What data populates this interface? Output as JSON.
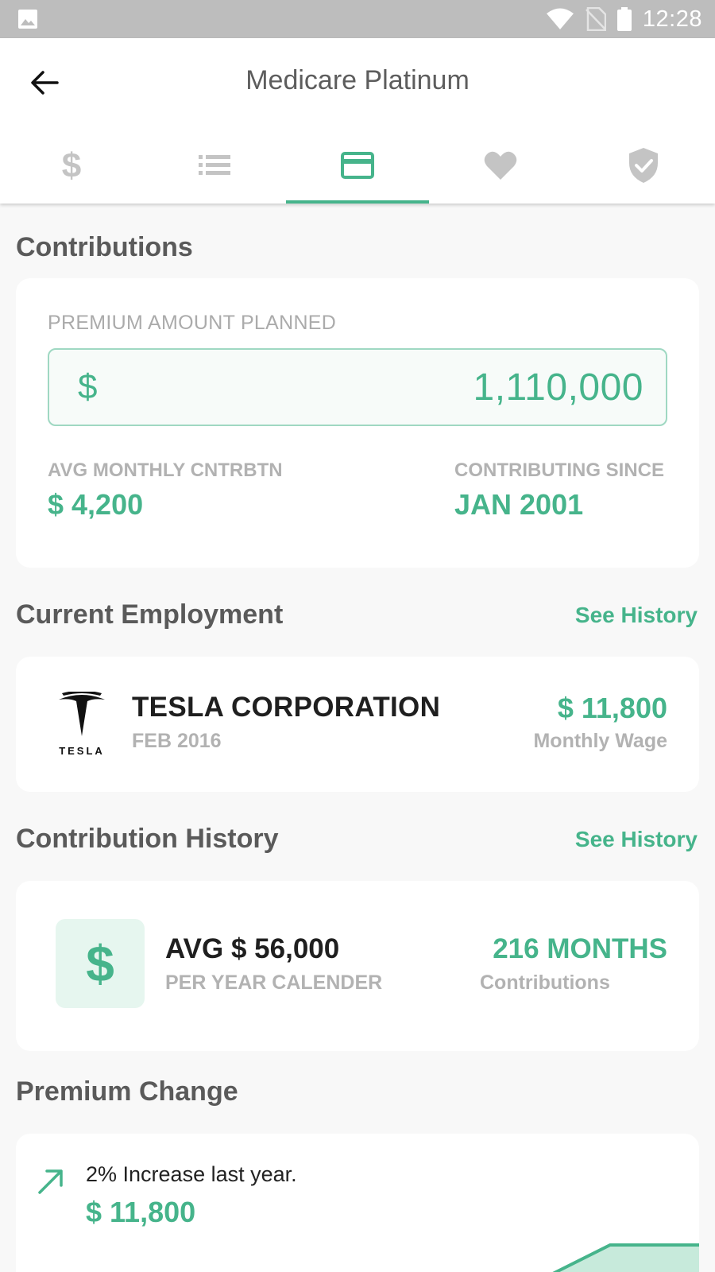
{
  "status_bar": {
    "time": "12:28"
  },
  "header": {
    "title": "Medicare Platinum"
  },
  "tabs": [
    {
      "icon": "dollar-icon",
      "active": false
    },
    {
      "icon": "list-icon",
      "active": false
    },
    {
      "icon": "credit-card-icon",
      "active": true
    },
    {
      "icon": "heart-icon",
      "active": false
    },
    {
      "icon": "shield-check-icon",
      "active": false
    }
  ],
  "colors": {
    "accent": "#46b48b",
    "tab_inactive": "#c4c4c4"
  },
  "contributions": {
    "title": "Contributions",
    "premium_label": "PREMIUM AMOUNT PLANNED",
    "currency": "$",
    "premium_amount": "1,110,000",
    "avg_monthly_label": "AVG MONTHLY CNTRBTN",
    "avg_monthly_value": "$ 4,200",
    "since_label": "CONTRIBUTING SINCE",
    "since_value": "JAN 2001"
  },
  "employment": {
    "title": "Current Employment",
    "see_history": "See History",
    "company": "TESLA CORPORATION",
    "logo_text": "TESLA",
    "start": "FEB 2016",
    "wage": "$ 11,800",
    "wage_label": "Monthly Wage"
  },
  "history": {
    "title": "Contribution History",
    "see_history": "See History",
    "icon_glyph": "$",
    "avg": "AVG $ 56,000",
    "avg_sub": "PER YEAR CALENDER",
    "months": "216 MONTHS",
    "months_sub": "Contributions"
  },
  "premium_change": {
    "title": "Premium Change",
    "text": "2% Increase last year.",
    "value": "$ 11,800"
  }
}
